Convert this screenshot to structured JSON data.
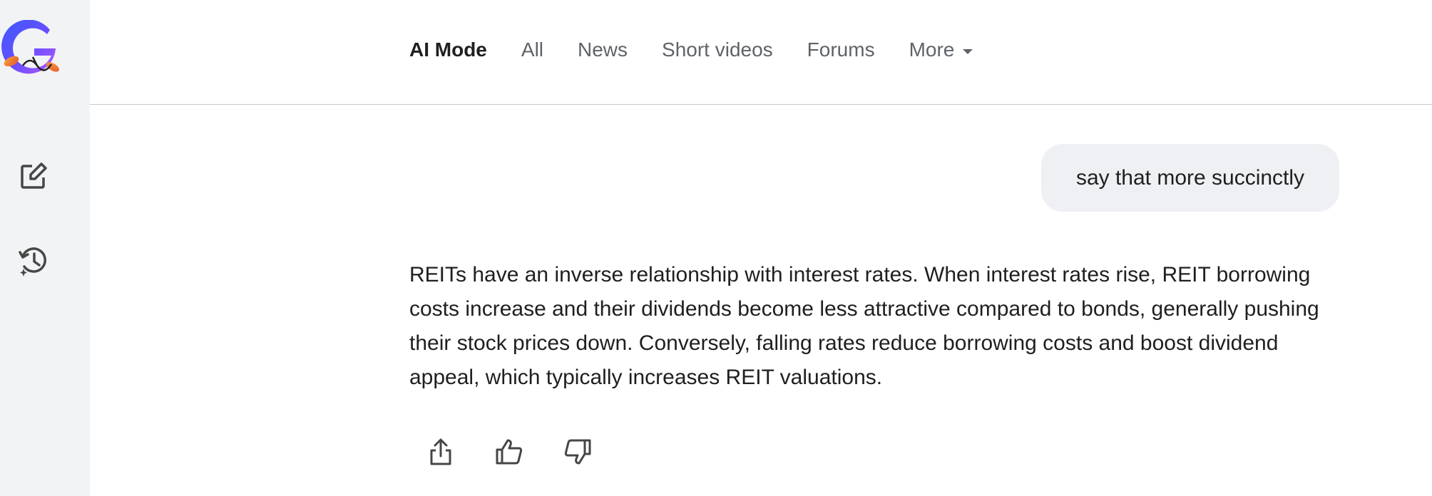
{
  "sidebar": {
    "logo_icon": "google-ai-mode-logo-icon",
    "items": [
      {
        "icon": "new-chat-icon"
      },
      {
        "icon": "history-icon"
      }
    ]
  },
  "header": {
    "tabs": [
      {
        "label": "AI Mode",
        "active": true
      },
      {
        "label": "All"
      },
      {
        "label": "News"
      },
      {
        "label": "Short videos"
      },
      {
        "label": "Forums"
      },
      {
        "label": "More"
      }
    ]
  },
  "conversation": {
    "user_message": "say that more succinctly",
    "answer": "REITs have an inverse relationship with interest rates. When interest rates rise, REIT borrowing costs increase and their dividends become less attractive compared to bonds, generally pushing their stock prices down. Conversely, falling rates reduce borrowing costs and boost dividend appeal, which typically increases REIT valuations."
  },
  "actions": {
    "icons": [
      "share-icon",
      "thumbs-up-icon",
      "thumbs-down-icon"
    ]
  },
  "colors": {
    "sidebar_bg": "#f2f3f5",
    "bubble_bg": "#eef0f3",
    "tab_inactive": "#5f6368",
    "text_primary": "#1f1f1f",
    "divider": "#c7c9cc"
  }
}
